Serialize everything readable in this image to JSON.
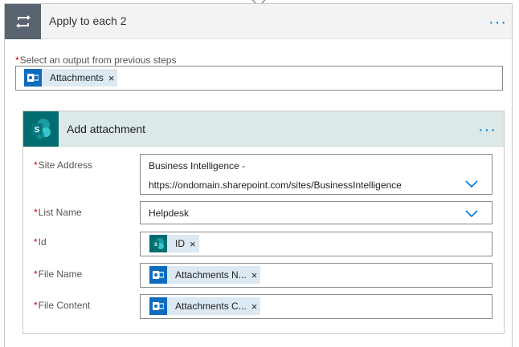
{
  "outer": {
    "title": "Apply to each 2",
    "more_label": "···",
    "select_label": "Select an output from previous steps",
    "required_mark": "*",
    "token": {
      "label": "Attachments",
      "remove": "×",
      "icon": "outlook-icon"
    }
  },
  "inner": {
    "title": "Add attachment",
    "more_label": "···",
    "icon": "sharepoint-icon",
    "fields": {
      "site_address": {
        "label": "Site Address",
        "value_line1": "Business Intelligence -",
        "value_line2": "https://ondomain.sharepoint.com/sites/BusinessIntelligence"
      },
      "list_name": {
        "label": "List Name",
        "value": "Helpdesk"
      },
      "id": {
        "label": "Id",
        "token": "ID",
        "remove": "×"
      },
      "file_name": {
        "label": "File Name",
        "token": "Attachments N...",
        "remove": "×"
      },
      "file_content": {
        "label": "File Content",
        "token": "Attachments C...",
        "remove": "×"
      }
    }
  },
  "colors": {
    "accent": "#0078d4",
    "loop_icon_bg": "#5a6370",
    "sharepoint_bg": "#036c70",
    "token_bg": "#dce9f3",
    "required": "#cc0000"
  }
}
